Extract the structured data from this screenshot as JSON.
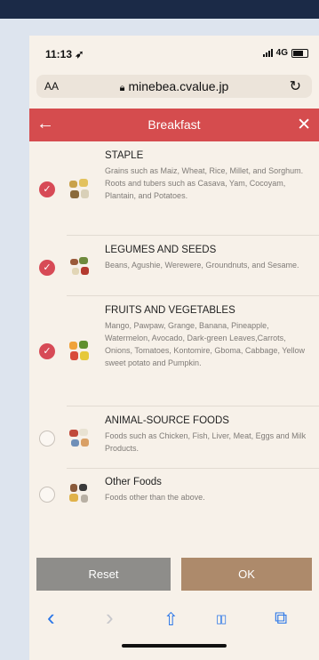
{
  "status_bar": {
    "time": "11:13",
    "network": "4G"
  },
  "browser": {
    "text_size_label": "AA",
    "url": "minebea.cvalue.jp",
    "reload_glyph": "↻"
  },
  "header": {
    "back_glyph": "←",
    "title": "Breakfast",
    "close_glyph": "✕"
  },
  "food_groups": [
    {
      "name": "STAPLE",
      "description": "Grains such as Maiz, Wheat, Rice, Millet, and Sorghum. Roots and tubers such as Casava, Yam, Cocoyam, Plantain, and Potatoes.",
      "checked": true,
      "check_glyph": "✓"
    },
    {
      "name": "LEGUMES AND SEEDS",
      "description": "Beans, Agushie, Werewere, Groundnuts, and Sesame.",
      "checked": true,
      "check_glyph": "✓"
    },
    {
      "name": "FRUITS AND VEGETABLES",
      "description": "Mango, Pawpaw, Grange, Banana, Pineapple, Watermelon, Avocado, Dark-green Leaves,Carrots, Onions, Tomatoes, Kontomire, Gboma, Cabbage, Yellow sweet potato and Pumpkin.",
      "checked": true,
      "check_glyph": "✓"
    },
    {
      "name": "ANIMAL-SOURCE FOODS",
      "description": "Foods such as Chicken, Fish, Liver, Meat, Eggs and Milk Products.",
      "checked": false
    },
    {
      "name": "Other Foods",
      "description": "Foods other than the above.",
      "checked": false
    }
  ],
  "buttons": {
    "reset": "Reset",
    "ok": "OK"
  },
  "toolbar": {
    "back_glyph": "‹",
    "forward_glyph": "›",
    "share_glyph": "⇧",
    "bookmarks_glyph": "▯▯",
    "tabs_glyph": "⧉"
  },
  "colors": {
    "accent": "#d54c4e",
    "check": "#d74a56",
    "ok_button": "#ad8a6b",
    "reset_button": "#8e8d8a",
    "ios_blue": "#2a76e8"
  }
}
